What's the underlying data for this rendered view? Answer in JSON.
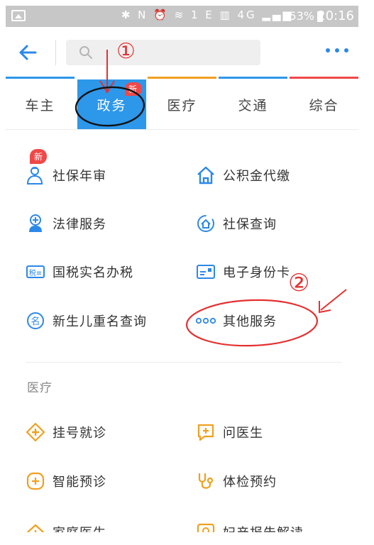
{
  "status_bar": {
    "indicator_icons": "✱ N ⏰ ≋ 1 E ▥ 4G ▂▄▆",
    "battery": "53%",
    "time": "20:16"
  },
  "header": {
    "search_placeholder": ""
  },
  "tabs": [
    {
      "label": "车主",
      "active": false
    },
    {
      "label": "政务",
      "active": true,
      "badge": "新"
    },
    {
      "label": "医疗",
      "active": false
    },
    {
      "label": "交通",
      "active": false
    },
    {
      "label": "综合",
      "active": false
    }
  ],
  "gov_section": {
    "new_badge": "新",
    "items": [
      {
        "label": "社保年审",
        "icon": "person-badge-icon"
      },
      {
        "label": "公积金代缴",
        "icon": "house-icon"
      },
      {
        "label": "法律服务",
        "icon": "law-icon"
      },
      {
        "label": "社保查询",
        "icon": "search-house-icon"
      },
      {
        "label": "国税实名办税",
        "icon": "tax-icon"
      },
      {
        "label": "电子身份卡",
        "icon": "id-card-icon"
      },
      {
        "label": "新生儿重名查询",
        "icon": "name-search-icon"
      },
      {
        "label": "其他服务",
        "icon": "more-dots-icon"
      }
    ]
  },
  "medical_section": {
    "title": "医疗",
    "items": [
      {
        "label": "挂号就诊",
        "icon": "cross-diamond-icon"
      },
      {
        "label": "问医生",
        "icon": "chat-plus-icon"
      },
      {
        "label": "智能预诊",
        "icon": "smart-diagnosis-icon"
      },
      {
        "label": "体检预约",
        "icon": "stethoscope-icon"
      },
      {
        "label": "家庭医生",
        "icon": "family-doctor-icon"
      },
      {
        "label": "妇产报告解读",
        "icon": "report-icon"
      }
    ]
  },
  "annotations": {
    "marker_1": "①",
    "marker_2": "②"
  },
  "colors": {
    "accent": "#2d97ea",
    "badge": "#f04848",
    "icon_blue": "#2c88e8",
    "icon_orange": "#f0a020",
    "annotation_red": "#e53030"
  }
}
